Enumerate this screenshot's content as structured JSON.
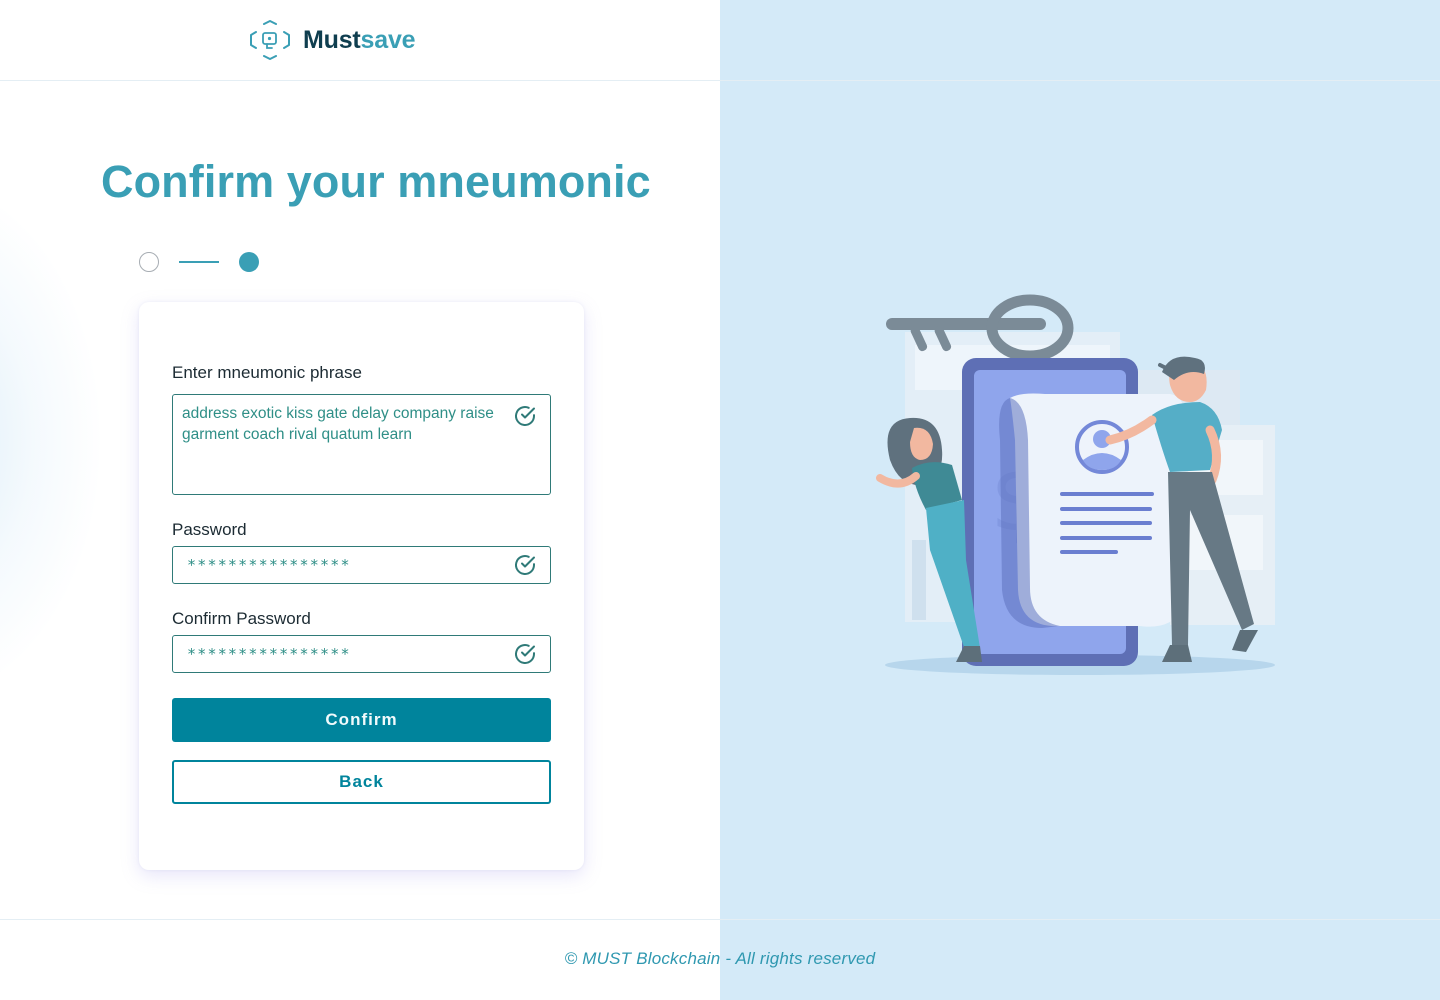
{
  "brand": {
    "name_part1": "Must",
    "name_part2": "save",
    "logo_icon": "hexagon-chip-logo-icon"
  },
  "page": {
    "title": "Confirm your mneumonic"
  },
  "stepper": {
    "total_steps": 2,
    "current_step": 2
  },
  "form": {
    "mnemonic": {
      "label": "Enter mneumonic phrase",
      "value": "address exotic kiss gate delay company raise garment coach rival quatum learn",
      "valid": true
    },
    "password": {
      "label": "Password",
      "value": "****************",
      "valid": true
    },
    "confirm_password": {
      "label": "Confirm Password",
      "value": "****************",
      "valid": true
    },
    "confirm_button": "Confirm",
    "back_button": "Back"
  },
  "footer": {
    "text": "© MUST Blockchain - All rights reserved"
  },
  "illustration": {
    "description_icon": "key-phone-document-people-illustration"
  },
  "colors": {
    "accent": "#3a9fb5",
    "primary_button": "#00849c",
    "brand_dark": "#0f3e4f",
    "field_border": "#2f7a78",
    "right_panel": "#d4eaf8"
  }
}
